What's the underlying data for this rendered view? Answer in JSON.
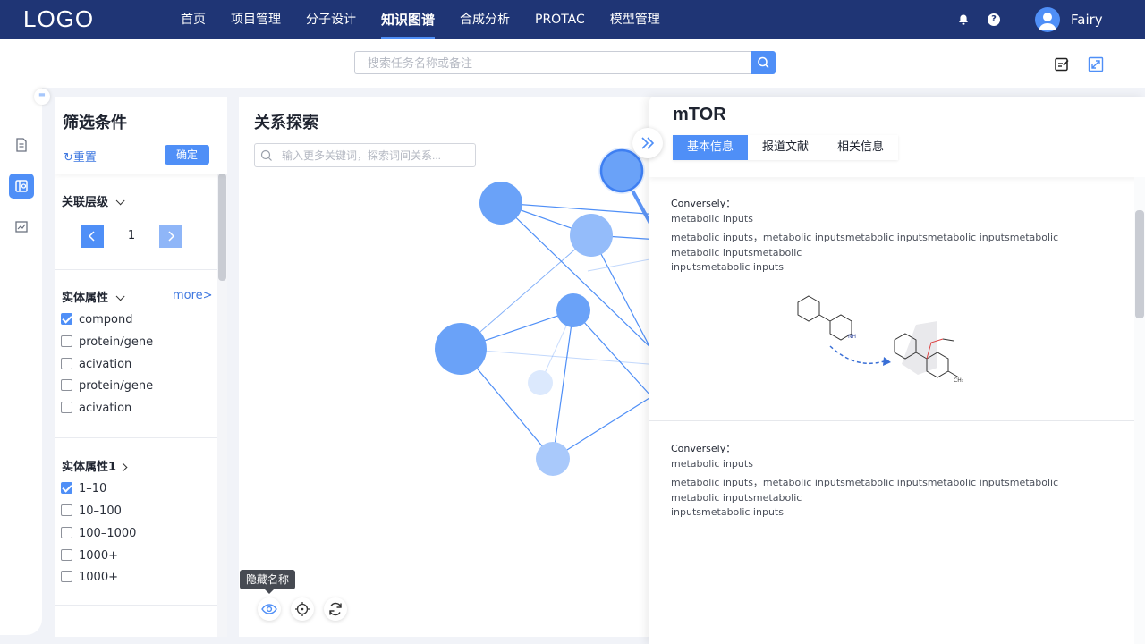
{
  "app": {
    "logo": "LOGO",
    "user_name": "Fairy"
  },
  "nav": {
    "items": [
      {
        "label": "首页",
        "active": false
      },
      {
        "label": "项目管理",
        "active": false
      },
      {
        "label": "分子设计",
        "active": false
      },
      {
        "label": "知识图谱",
        "active": true
      },
      {
        "label": "合成分析",
        "active": false
      },
      {
        "label": "PROTAC",
        "active": false
      },
      {
        "label": "模型管理",
        "active": false
      }
    ]
  },
  "search": {
    "placeholder": "搜索任务名称或备注",
    "value": ""
  },
  "filter": {
    "title": "筛选条件",
    "reset_label": "重置",
    "confirm_label": "确定",
    "level_section": {
      "title": "关联层级",
      "value": "1"
    },
    "entity_section": {
      "title": "实体属性",
      "more_label": "more>",
      "options": [
        {
          "label": "compond",
          "checked": true
        },
        {
          "label": "protein/gene",
          "checked": false
        },
        {
          "label": "acivation",
          "checked": false
        },
        {
          "label": "protein/gene",
          "checked": false
        },
        {
          "label": "acivation",
          "checked": false
        }
      ]
    },
    "entity1_section": {
      "title": "实体属性1",
      "options": [
        {
          "label": "1–10",
          "checked": true
        },
        {
          "label": "10–100",
          "checked": false
        },
        {
          "label": "100–1000",
          "checked": false
        },
        {
          "label": "1000+",
          "checked": false
        },
        {
          "label": "1000+",
          "checked": false
        }
      ]
    }
  },
  "graph": {
    "title": "关系探索",
    "keyword_placeholder": "输入更多关键词，探索词间关系...",
    "tooltip": "隐藏名称",
    "colors": {
      "node": "#6aa2f8",
      "node_light": "#a9c9fb",
      "node_faint": "#dce9fd",
      "edge": "#4f8ff7",
      "selected": "#5d95f6"
    }
  },
  "detail": {
    "title": "mTOR",
    "tabs": [
      {
        "label": "基本信息",
        "active": true
      },
      {
        "label": "报道文献",
        "active": false
      },
      {
        "label": "相关信息",
        "active": false
      }
    ],
    "sections": [
      {
        "heading": "Conversely：",
        "lines": [
          "metabolic inputs",
          "metabolic inputs，metabolic inputsmetabolic inputsmetabolic inputsmetabolic",
          "metabolic inputsmetabolic",
          "inputsmetabolic inputs"
        ]
      },
      {
        "heading": "Conversely：",
        "lines": [
          "metabolic inputs",
          "metabolic inputs，metabolic inputsmetabolic inputsmetabolic inputsmetabolic",
          "metabolic inputsmetabolic",
          "inputsmetabolic inputs"
        ]
      }
    ],
    "molecule_labels": {
      "nh": "NH",
      "ch3": "CH₃"
    }
  },
  "theme": {
    "topbar": "#1f3575",
    "accent": "#4f8ff7"
  }
}
